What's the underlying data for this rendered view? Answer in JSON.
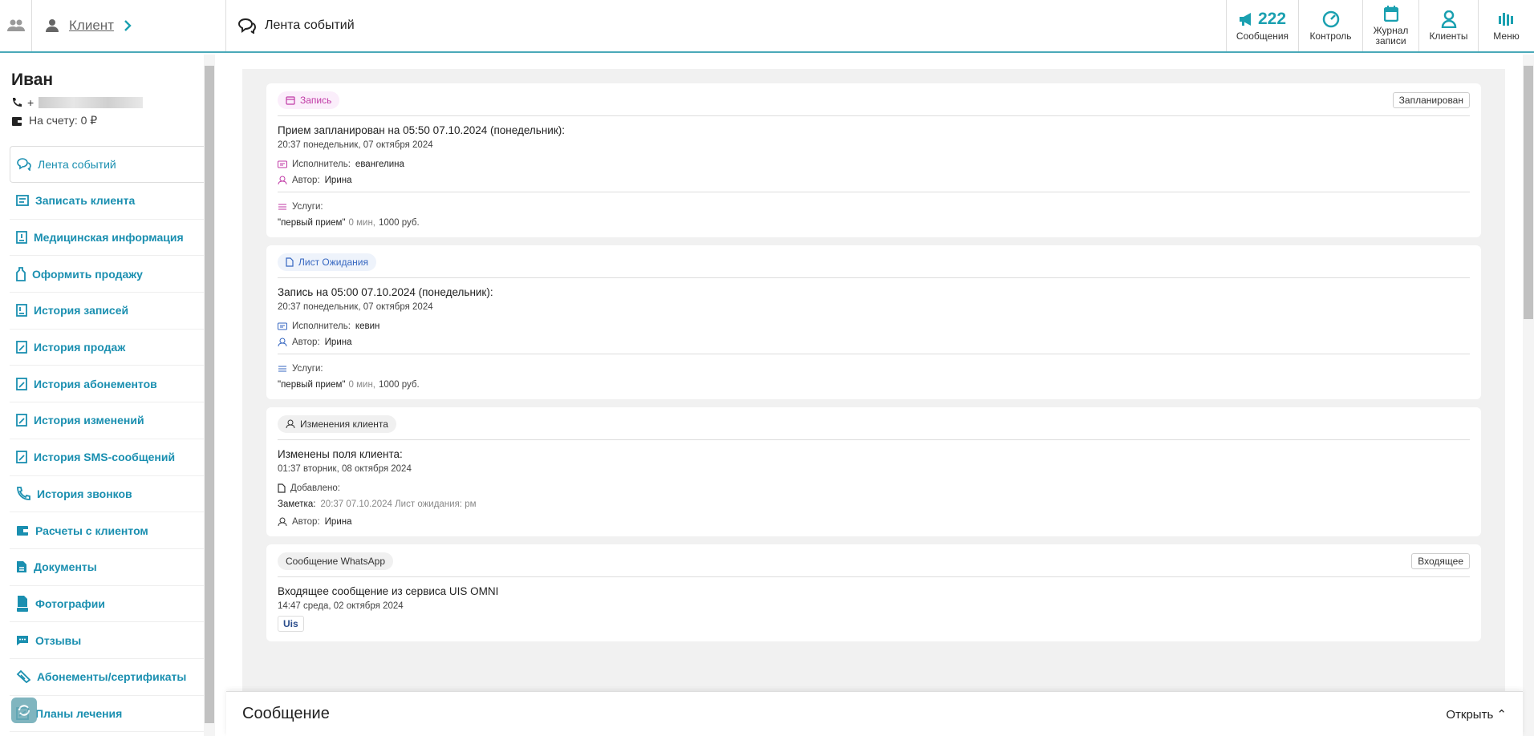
{
  "header": {
    "client_link": "Клиент",
    "title": "Лента событий",
    "buttons": [
      {
        "label": "Сообщения",
        "count": "222",
        "icon": "megaphone-icon"
      },
      {
        "label": "Контроль",
        "icon": "gauge-icon"
      },
      {
        "label": "Журнал записи",
        "icon": "calendar-icon"
      },
      {
        "label": "Клиенты",
        "icon": "person-icon"
      },
      {
        "label": "Меню",
        "icon": "menu-icon"
      }
    ]
  },
  "client": {
    "name": "Иван",
    "phone_prefix": "+",
    "balance": "На счету: 0 ₽"
  },
  "sidebar": {
    "items": [
      {
        "label": "Лента событий",
        "icon": "chat-icon"
      },
      {
        "label": "Записать клиента",
        "icon": "edit-list-icon"
      },
      {
        "label": "Медицинская информация",
        "icon": "medical-icon"
      },
      {
        "label": "Оформить продажу",
        "icon": "bottle-icon"
      },
      {
        "label": "История записей",
        "icon": "history-icon"
      },
      {
        "label": "История продаж",
        "icon": "history-icon"
      },
      {
        "label": "История абонементов",
        "icon": "history-icon"
      },
      {
        "label": "История изменений",
        "icon": "history-icon"
      },
      {
        "label": "История SMS-сообщений",
        "icon": "history-icon"
      },
      {
        "label": "История звонков",
        "icon": "phone-icon"
      },
      {
        "label": "Расчеты с клиентом",
        "icon": "wallet-icon"
      },
      {
        "label": "Документы",
        "icon": "document-icon"
      },
      {
        "label": "Фотографии",
        "icon": "photo-icon"
      },
      {
        "label": "Отзывы",
        "icon": "comment-icon"
      },
      {
        "label": "Абонементы/сертификаты",
        "icon": "ticket-icon"
      },
      {
        "label": "Планы лечения",
        "icon": "plan-icon"
      }
    ]
  },
  "feed": {
    "cards": [
      {
        "type_label": "Запись",
        "status": "Запланирован",
        "title": "Прием запланирован на 05:50 07.10.2024 (понедельник):",
        "time": "20:37 понедельник, 07 октября 2024",
        "executor_label": "Исполнитель:",
        "executor": "евангелина",
        "author_label": "Автор:",
        "author": "Ирина",
        "services_label": "Услуги:",
        "service_name": "\"первый прием\"",
        "service_duration": "0 мин,",
        "service_price": "1000 руб."
      },
      {
        "type_label": "Лист Ожидания",
        "title": "Запись на 05:00 07.10.2024 (понедельник):",
        "time": "20:37 понедельник, 07 октября 2024",
        "executor_label": "Исполнитель:",
        "executor": "кевин",
        "author_label": "Автор:",
        "author": "Ирина",
        "services_label": "Услуги:",
        "service_name": "\"первый прием\"",
        "service_duration": "0 мин,",
        "service_price": "1000 руб."
      },
      {
        "type_label": "Изменения клиента",
        "title": "Изменены поля клиента:",
        "time": "01:37 вторник, 08 октября 2024",
        "added_label": "Добавлено:",
        "note_label": "Заметка:",
        "note_value": "20:37 07.10.2024 Лист ожидания: рм",
        "author_label": "Автор:",
        "author": "Ирина"
      },
      {
        "type_label": "Сообщение WhatsApp",
        "status": "Входящее",
        "title": "Входящее сообщение из сервиса UIS OMNI",
        "time": "14:47 среда, 02 октября 2024",
        "tag": "Uis"
      }
    ]
  },
  "message_bar": {
    "title": "Сообщение",
    "open_label": "Открыть ⌃"
  }
}
